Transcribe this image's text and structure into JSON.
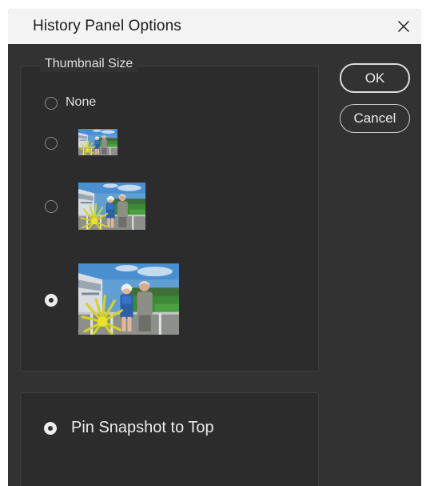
{
  "dialog": {
    "title": "History Panel Options"
  },
  "thumbnail_group": {
    "legend": "Thumbnail Size",
    "options": [
      {
        "label": "None",
        "selected": false
      },
      {
        "label": "",
        "size": "small",
        "selected": false
      },
      {
        "label": "",
        "size": "medium",
        "selected": false
      },
      {
        "label": "",
        "size": "large",
        "selected": true
      }
    ]
  },
  "pin_group": {
    "option_label": "Pin Snapshot to Top",
    "selected": true
  },
  "buttons": {
    "ok": "OK",
    "cancel": "Cancel"
  },
  "colors": {
    "dialog_bg": "#323232",
    "titlebar_bg": "#f3f3f3",
    "text": "#e0e0e0"
  },
  "icons": {
    "close": "close-icon",
    "thumbnail": "photo-thumbnail-icon"
  }
}
